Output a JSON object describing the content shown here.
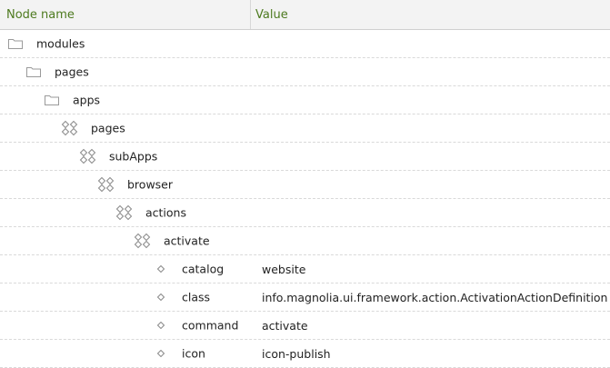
{
  "columns": {
    "name": "Node name",
    "value": "Value"
  },
  "rows": [
    {
      "type": "folder",
      "depth": 0,
      "label": "modules",
      "value": ""
    },
    {
      "type": "folder",
      "depth": 1,
      "label": "pages",
      "value": ""
    },
    {
      "type": "folder",
      "depth": 2,
      "label": "apps",
      "value": ""
    },
    {
      "type": "content",
      "depth": 3,
      "label": "pages",
      "value": ""
    },
    {
      "type": "content",
      "depth": 4,
      "label": "subApps",
      "value": ""
    },
    {
      "type": "content",
      "depth": 5,
      "label": "browser",
      "value": ""
    },
    {
      "type": "content",
      "depth": 6,
      "label": "actions",
      "value": ""
    },
    {
      "type": "content",
      "depth": 7,
      "label": "activate",
      "value": ""
    },
    {
      "type": "property",
      "depth": 8,
      "label": "catalog",
      "value": "website"
    },
    {
      "type": "property",
      "depth": 8,
      "label": "class",
      "value": "info.magnolia.ui.framework.action.ActivationActionDefinition"
    },
    {
      "type": "property",
      "depth": 8,
      "label": "command",
      "value": "activate"
    },
    {
      "type": "property",
      "depth": 8,
      "label": "icon",
      "value": "icon-publish"
    }
  ]
}
